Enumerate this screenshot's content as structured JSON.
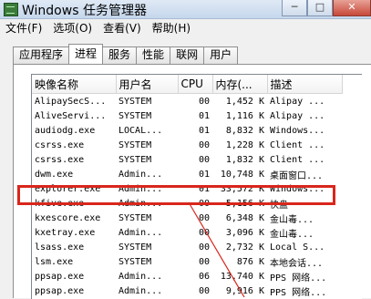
{
  "window": {
    "title": "Windows 任务管理器",
    "controls": {
      "minimize": "─",
      "maximize": "□",
      "close": "✕"
    }
  },
  "menu": [
    "文件(F)",
    "选项(O)",
    "查看(V)",
    "帮助(H)"
  ],
  "tabs": [
    "应用程序",
    "进程",
    "服务",
    "性能",
    "联网",
    "用户"
  ],
  "active_tab": "进程",
  "table": {
    "columns": [
      "映像名称",
      "用户名",
      "CPU",
      "内存(...",
      "描述"
    ],
    "rows": [
      [
        "AlipaySecS...",
        "SYSTEM",
        "00",
        "1,452 K",
        "Alipay ..."
      ],
      [
        "AliveServi...",
        "SYSTEM",
        "01",
        "1,116 K",
        "Alipay ..."
      ],
      [
        "audiodg.exe",
        "LOCAL...",
        "01",
        "8,832 K",
        "Windows..."
      ],
      [
        "csrss.exe",
        "SYSTEM",
        "00",
        "1,228 K",
        "Client ..."
      ],
      [
        "csrss.exe",
        "SYSTEM",
        "00",
        "1,832 K",
        "Client ..."
      ],
      [
        "dwm.exe",
        "Admin...",
        "01",
        "10,748 K",
        "桌面窗口..."
      ],
      [
        "explorer.exe",
        "Admin...",
        "01",
        "33,572 K",
        "Windows..."
      ],
      [
        "kfive.exe",
        "Admin...",
        "00",
        "5,156 K",
        "快盘"
      ],
      [
        "kxescore.exe",
        "SYSTEM",
        "00",
        "6,348 K",
        "金山毒..."
      ],
      [
        "kxetray.exe",
        "Admin...",
        "00",
        "3,096 K",
        "金山毒..."
      ],
      [
        "lsass.exe",
        "SYSTEM",
        "00",
        "2,732 K",
        "Local S..."
      ],
      [
        "lsm.exe",
        "SYSTEM",
        "00",
        "876 K",
        "本地会话..."
      ],
      [
        "ppsap.exe",
        "Admin...",
        "06",
        "13,740 K",
        "PPS 网络..."
      ],
      [
        "ppsap.exe",
        "Admin...",
        "00",
        "9,916 K",
        "PPS 网络..."
      ]
    ],
    "highlighted_row": "explorer.exe"
  },
  "colors": {
    "highlight": "#d9261c"
  },
  "icons": [
    "task-manager-icon",
    "scroll-up-arrow-icon"
  ]
}
